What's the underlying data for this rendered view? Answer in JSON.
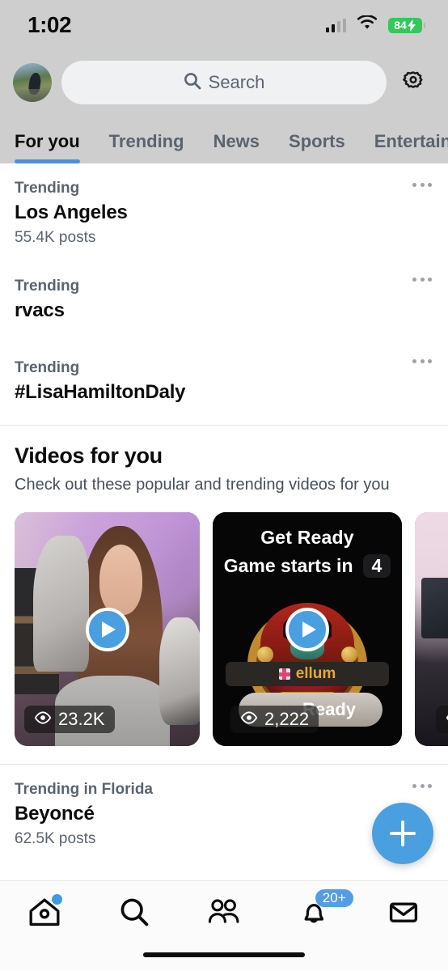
{
  "status_bar": {
    "time": "1:02",
    "signal_icon": "cellular-signal-icon",
    "wifi_icon": "wifi-icon",
    "battery_level": "84",
    "battery_icon": "battery-charging-icon"
  },
  "header": {
    "avatar_name": "profile-avatar",
    "search_placeholder": "Search",
    "search_icon": "search-icon",
    "settings_icon": "gear-icon"
  },
  "tabs": [
    {
      "label": "For you",
      "active": true
    },
    {
      "label": "Trending",
      "active": false
    },
    {
      "label": "News",
      "active": false
    },
    {
      "label": "Sports",
      "active": false
    },
    {
      "label": "Entertainm",
      "active": false
    }
  ],
  "trends_top": [
    {
      "category": "Trending",
      "name": "Los Angeles",
      "posts": "55.4K posts"
    },
    {
      "category": "Trending",
      "name": "rvacs",
      "posts": ""
    },
    {
      "category": "Trending",
      "name": "#LisaHamiltonDaly",
      "posts": ""
    }
  ],
  "videos": {
    "title": "Videos for you",
    "subtitle": "Check out these popular and trending videos for you",
    "cards": [
      {
        "kind": "streamer",
        "views": "23.2K",
        "views_icon": "eye-icon",
        "play_icon": "play-icon"
      },
      {
        "kind": "game-lobby",
        "heading": "Get Ready",
        "subheading": "Game starts in",
        "countdown": "4",
        "player_name": "ellum",
        "player_badge_icon": "flag-icon",
        "ready_label": "Ready",
        "views": "2,222",
        "views_icon": "eye-icon",
        "play_icon": "play-icon"
      },
      {
        "kind": "room",
        "views": "",
        "views_icon": "eye-icon"
      }
    ]
  },
  "trend_bottom": {
    "category": "Trending in Florida",
    "name": "Beyoncé",
    "posts": "62.5K posts"
  },
  "compose_button": {
    "icon": "plus-icon"
  },
  "bottom_nav": [
    {
      "icon": "home-icon",
      "badge": "",
      "dot": true
    },
    {
      "icon": "search-icon",
      "badge": "",
      "dot": false
    },
    {
      "icon": "communities-icon",
      "badge": "",
      "dot": false
    },
    {
      "icon": "bell-icon",
      "badge": "20+",
      "dot": false
    },
    {
      "icon": "mail-icon",
      "badge": "",
      "dot": false
    }
  ],
  "colors": {
    "accent": "#4a9fe0",
    "header_bg": "#cecece",
    "battery_green": "#34c759",
    "muted_text": "#5a646e"
  }
}
